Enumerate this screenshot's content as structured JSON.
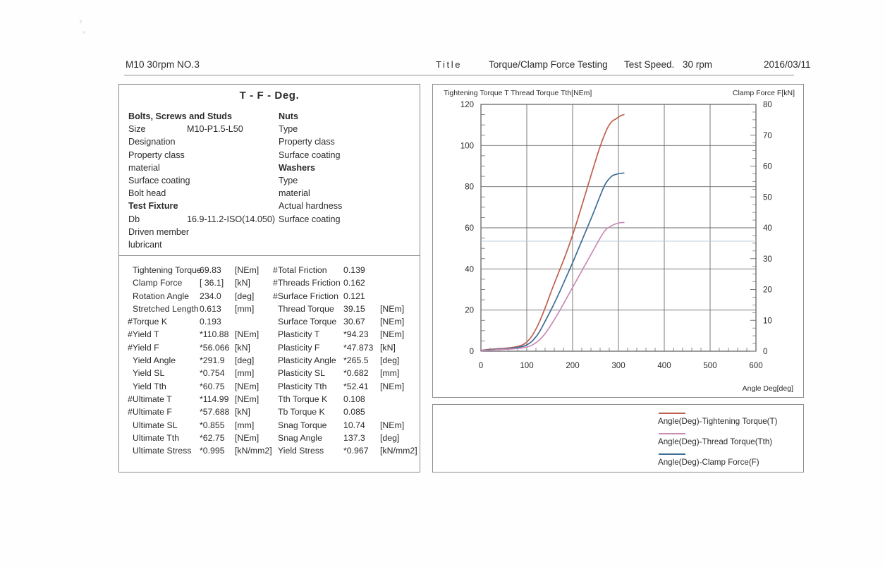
{
  "header": {
    "sample_id": "M10 30rpm NO.3",
    "title_label": "Title",
    "title_value": "Torque/Clamp Force Testing",
    "speed_label": "Test Speed.",
    "speed_value": "30 rpm",
    "date": "2016/03/11"
  },
  "info_panel": {
    "title": "T - F - Deg.",
    "spec_left": [
      {
        "key": "Bolts, Screws and Studs",
        "value": "",
        "bold": true
      },
      {
        "key": "Size",
        "value": "M10-P1.5-L50",
        "bold": false
      },
      {
        "key": "Designation",
        "value": "",
        "bold": false
      },
      {
        "key": "Property class",
        "value": "",
        "bold": false
      },
      {
        "key": "material",
        "value": "",
        "bold": false
      },
      {
        "key": "Surface coating",
        "value": "",
        "bold": false
      },
      {
        "key": "Bolt head",
        "value": "",
        "bold": false
      },
      {
        "key": "Test Fixture",
        "value": "",
        "bold": true
      },
      {
        "key": "Db",
        "value": "16.9-11.2-ISO(14.050)",
        "bold": false
      },
      {
        "key": "Driven member",
        "value": "",
        "bold": false
      },
      {
        "key": "lubricant",
        "value": "",
        "bold": false
      }
    ],
    "spec_right": [
      {
        "key": "Nuts",
        "value": "",
        "bold": true
      },
      {
        "key": "Type",
        "value": "",
        "bold": false
      },
      {
        "key": "Property class",
        "value": "",
        "bold": false
      },
      {
        "key": "Surface coating",
        "value": "",
        "bold": false
      },
      {
        "key": "Washers",
        "value": "",
        "bold": true
      },
      {
        "key": "Type",
        "value": "",
        "bold": false
      },
      {
        "key": "material",
        "value": "",
        "bold": false
      },
      {
        "key": "Actual hardness",
        "value": "",
        "bold": false
      },
      {
        "key": "Surface coating",
        "value": "",
        "bold": false
      }
    ],
    "results_left": [
      {
        "label": "Tightening Torque",
        "value": "69.83",
        "unit": "[NEm]",
        "indent": true
      },
      {
        "label": "Clamp Force",
        "value": "[ 36.1]",
        "unit": "[kN]",
        "indent": true
      },
      {
        "label": "Rotation Angle",
        "value": "234.0",
        "unit": "[deg]",
        "indent": true
      },
      {
        "label": "Stretched Length",
        "value": "0.613",
        "unit": "[mm]",
        "indent": true
      },
      {
        "label": "#Torque K",
        "value": "0.193",
        "unit": "",
        "indent": false
      },
      {
        "label": "#Yield T",
        "value": "*110.88",
        "unit": "[NEm]",
        "indent": false
      },
      {
        "label": "#Yield F",
        "value": "*56.066",
        "unit": "[kN]",
        "indent": false
      },
      {
        "label": "Yield Angle",
        "value": "*291.9",
        "unit": "[deg]",
        "indent": true
      },
      {
        "label": "Yield SL",
        "value": "*0.754",
        "unit": "[mm]",
        "indent": true
      },
      {
        "label": "Yield Tth",
        "value": "*60.75",
        "unit": "[NEm]",
        "indent": true
      },
      {
        "label": "#Ultimate T",
        "value": "*114.99",
        "unit": "[NEm]",
        "indent": false
      },
      {
        "label": "#Ultimate F",
        "value": "*57.688",
        "unit": "[kN]",
        "indent": false
      },
      {
        "label": "Ultimate SL",
        "value": "*0.855",
        "unit": "[mm]",
        "indent": true
      },
      {
        "label": "Ultimate Tth",
        "value": "*62.75",
        "unit": "[NEm]",
        "indent": true
      },
      {
        "label": "Ultimate Stress",
        "value": "*0.995",
        "unit": "[kN/mm2]",
        "indent": true
      }
    ],
    "results_right": [
      {
        "label": "#Total Friction",
        "value": "0.139",
        "unit": "",
        "indent": false
      },
      {
        "label": "#Threads Friction",
        "value": "0.162",
        "unit": "",
        "indent": false
      },
      {
        "label": "#Surface Friction",
        "value": "0.121",
        "unit": "",
        "indent": false
      },
      {
        "label": "Thread Torque",
        "value": "39.15",
        "unit": "[NEm]",
        "indent": true
      },
      {
        "label": "Surface Torque",
        "value": "30.67",
        "unit": "[NEm]",
        "indent": true
      },
      {
        "label": "Plasticity T",
        "value": "*94.23",
        "unit": "[NEm]",
        "indent": true
      },
      {
        "label": "Plasticity F",
        "value": "*47.873",
        "unit": "[kN]",
        "indent": true
      },
      {
        "label": "Plasticity Angle",
        "value": "*265.5",
        "unit": "[deg]",
        "indent": true
      },
      {
        "label": "Plasticity SL",
        "value": "*0.682",
        "unit": "[mm]",
        "indent": true
      },
      {
        "label": "Plasticity Tth",
        "value": "*52.41",
        "unit": "[NEm]",
        "indent": true
      },
      {
        "label": "Tth Torque K",
        "value": "0.108",
        "unit": "",
        "indent": true
      },
      {
        "label": "Tb Torque K",
        "value": "0.085",
        "unit": "",
        "indent": true
      },
      {
        "label": "Snag Torque",
        "value": "10.74",
        "unit": "[NEm]",
        "indent": true
      },
      {
        "label": "Snag Angle",
        "value": "137.3",
        "unit": "[deg]",
        "indent": true
      },
      {
        "label": "Yield Stress",
        "value": "*0.967",
        "unit": "[kN/mm2]",
        "indent": true
      }
    ]
  },
  "legend": {
    "items": [
      {
        "label": "Angle(Deg)-Tightening Torque(T)",
        "color": "#c0604c"
      },
      {
        "label": "Angle(Deg)-Thread Torque(Tth)",
        "color": "#c98cb4"
      },
      {
        "label": "Angle(Deg)-Clamp Force(F)",
        "color": "#3d6c96"
      }
    ]
  },
  "chart_data": {
    "type": "line",
    "title": "",
    "left_axis_title": "Tightening Torque T Thread Torque Tth[NEm]",
    "right_axis_title": "Clamp Force F[kN]",
    "xlabel": "Angle Deg[deg]",
    "ylabel": "Tightening Torque T Thread Torque Tth[NEm]",
    "xlim": [
      0,
      600
    ],
    "ylim": [
      0,
      120
    ],
    "y2lim": [
      0,
      80
    ],
    "xticks": [
      0,
      100,
      200,
      300,
      400,
      500,
      600
    ],
    "yticks": [
      0,
      20,
      40,
      60,
      80,
      100,
      120
    ],
    "y2ticks": [
      0,
      10,
      20,
      30,
      40,
      50,
      60,
      70,
      80
    ],
    "grid": true,
    "legend_position": "below-right",
    "series": [
      {
        "name": "Angle(Deg)-Tightening Torque(T)",
        "color": "#c0604c",
        "axis": "left",
        "x": [
          0,
          20,
          40,
          60,
          80,
          95,
          110,
          125,
          140,
          155,
          170,
          185,
          200,
          215,
          230,
          245,
          260,
          275,
          285,
          295,
          305,
          312
        ],
        "y": [
          0.4,
          0.9,
          1.2,
          1.6,
          2.3,
          3.6,
          7.0,
          13.0,
          21.0,
          30.0,
          38.5,
          47.0,
          56.5,
          67.0,
          78.0,
          89.0,
          99.5,
          108.0,
          111.5,
          113.0,
          114.5,
          115.0
        ]
      },
      {
        "name": "Angle(Deg)-Clamp Force(F)",
        "color": "#3d6c96",
        "axis": "left",
        "x": [
          0,
          20,
          40,
          60,
          80,
          95,
          110,
          125,
          140,
          155,
          170,
          185,
          200,
          215,
          230,
          245,
          260,
          272,
          285,
          295,
          305,
          312
        ],
        "y": [
          0.3,
          0.7,
          1.0,
          1.3,
          1.9,
          2.6,
          4.6,
          8.5,
          14.5,
          21.0,
          28.0,
          35.5,
          43.0,
          51.0,
          59.0,
          67.0,
          75.5,
          81.5,
          85.0,
          86.0,
          86.5,
          86.6
        ]
      },
      {
        "name": "Angle(Deg)-Thread Torque(Tth)",
        "color": "#c98cb4",
        "axis": "left",
        "x": [
          0,
          20,
          40,
          60,
          80,
          95,
          110,
          125,
          140,
          155,
          170,
          185,
          200,
          215,
          230,
          245,
          260,
          272,
          285,
          295,
          305,
          312
        ],
        "y": [
          0.2,
          0.5,
          0.8,
          1.0,
          1.3,
          1.8,
          2.8,
          5.0,
          8.5,
          13.5,
          19.0,
          25.0,
          31.0,
          37.0,
          43.0,
          49.0,
          55.0,
          59.0,
          61.0,
          62.0,
          62.5,
          62.6
        ]
      }
    ],
    "reference_lines": [
      {
        "value": 53.5,
        "axis": "left",
        "color": "#b8cfe0"
      }
    ]
  }
}
